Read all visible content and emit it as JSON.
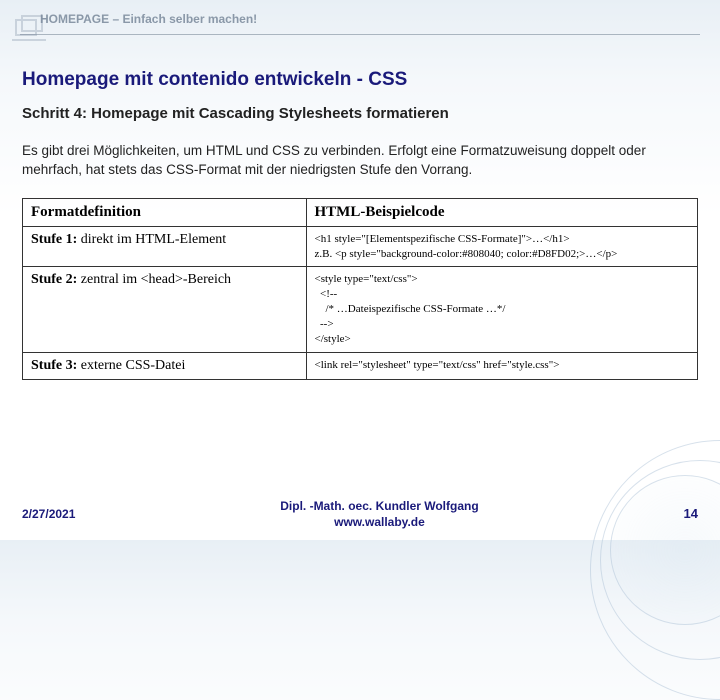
{
  "header": {
    "tagline": "HOMEPAGE – Einfach selber machen!"
  },
  "page": {
    "title": "Homepage mit contenido entwickeln - CSS",
    "subtitle": "Schritt 4: Homepage mit Cascading Stylesheets formatieren",
    "body": "Es gibt drei Möglichkeiten, um HTML und CSS zu verbinden. Erfolgt eine Formatzuweisung doppelt oder mehrfach, hat stets das CSS-Format mit der niedrigsten Stufe den Vorrang."
  },
  "table": {
    "head": {
      "col1": "Formatdefinition",
      "col2": "HTML-Beispielcode"
    },
    "rows": [
      {
        "label_strong": "Stufe 1:",
        "label_rest": " direkt im HTML-Element",
        "code": "<h1 style=\"[Elementspezifische CSS-Formate]\">…</h1>\nz.B. <p style=\"background-color:#808040; color:#D8FD02;>…</p>"
      },
      {
        "label_strong": "Stufe 2:",
        "label_rest": " zentral im <head>-Bereich",
        "code": "<style type=\"text/css\">\n  <!--\n    /* …Dateispezifische CSS-Formate …*/\n  -->\n</style>"
      },
      {
        "label_strong": "Stufe 3:",
        "label_rest": " externe CSS-Datei",
        "code": "<link rel=\"stylesheet\" type=\"text/css\" href=\"style.css\">"
      }
    ]
  },
  "footer": {
    "date": "2/27/2021",
    "author_line1": "Dipl. -Math. oec. Kundler Wolfgang",
    "author_line2": "www.wallaby.de",
    "page_number": "14"
  }
}
